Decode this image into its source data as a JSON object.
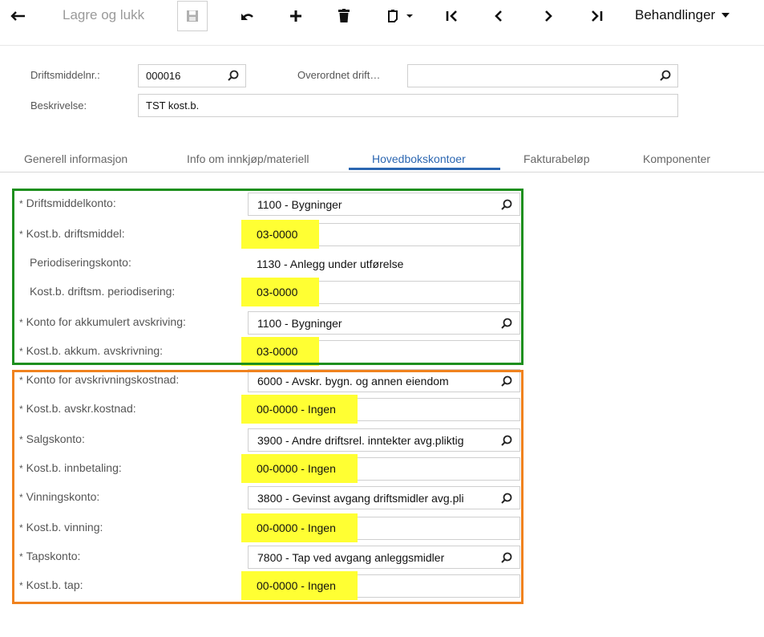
{
  "toolbar": {
    "back_icon": "back-arrow-icon",
    "save_close_label": "Lagre og lukk",
    "save_icon": "save-icon",
    "undo_icon": "undo-icon",
    "add_icon": "add-icon",
    "delete_icon": "delete-icon",
    "copy_paste_icon": "copy-paste-icon",
    "first_icon": "first-record-icon",
    "prev_icon": "previous-record-icon",
    "next_icon": "next-record-icon",
    "last_icon": "last-record-icon",
    "actions_label": "Behandlinger"
  },
  "header": {
    "asset_no_label": "Driftsmiddelnr.:",
    "asset_no_value": "000016",
    "parent_asset_label": "Overordnet drift…",
    "parent_asset_value": "",
    "description_label": "Beskrivelse:",
    "description_value": "TST kost.b."
  },
  "tabs": [
    {
      "label": "Generell informasjon",
      "active": false
    },
    {
      "label": "Info om innkjøp/materiell",
      "active": false
    },
    {
      "label": "Hovedbokskontoer",
      "active": true
    },
    {
      "label": "Fakturabeløp",
      "active": false
    },
    {
      "label": "Komponenter",
      "active": false
    }
  ],
  "accounts": {
    "rows": [
      {
        "label": "Driftsmiddelkonto:",
        "required": true,
        "value": "1100 - Bygninger",
        "kind": "lookup"
      },
      {
        "label": "Kost.b. driftsmiddel:",
        "required": true,
        "value": "03-0000",
        "kind": "highlight"
      },
      {
        "label": "Periodiseringskonto:",
        "required": false,
        "value": "1130 - Anlegg under utførelse",
        "kind": "readonly"
      },
      {
        "label": "Kost.b. driftsm. periodisering:",
        "required": false,
        "value": "03-0000",
        "kind": "highlight"
      },
      {
        "label": "Konto for akkumulert avskriving:",
        "required": true,
        "value": "1100 - Bygninger",
        "kind": "lookup"
      },
      {
        "label": "Kost.b. akkum. avskrivning:",
        "required": true,
        "value": "03-0000",
        "kind": "highlight"
      },
      {
        "label": "Konto for avskrivningskostnad:",
        "required": true,
        "value": "6000 - Avskr. bygn. og annen eiendom",
        "kind": "lookup"
      },
      {
        "label": "Kost.b. avskr.kostnad:",
        "required": true,
        "value": "00-0000 - Ingen",
        "kind": "highlight"
      },
      {
        "label": "Salgskonto:",
        "required": true,
        "value": "3900 - Andre driftsrel. inntekter avg.pliktig",
        "kind": "lookup"
      },
      {
        "label": "Kost.b. innbetaling:",
        "required": true,
        "value": "00-0000 - Ingen",
        "kind": "highlight"
      },
      {
        "label": "Vinningskonto:",
        "required": true,
        "value": "3800 - Gevinst avgang driftsmidler avg.pli",
        "kind": "lookup"
      },
      {
        "label": "Kost.b. vinning:",
        "required": true,
        "value": "00-0000 - Ingen",
        "kind": "highlight"
      },
      {
        "label": "Tapskonto:",
        "required": true,
        "value": "7800 - Tap ved avgang anleggsmidler",
        "kind": "lookup"
      },
      {
        "label": "Kost.b. tap:",
        "required": true,
        "value": "00-0000 - Ingen",
        "kind": "highlight"
      }
    ],
    "required_marker": "*"
  },
  "colors": {
    "group1_border": "#1e8f1e",
    "group2_border": "#f0821e",
    "highlight": "#ffff33",
    "active_tab": "#2b66b1"
  }
}
